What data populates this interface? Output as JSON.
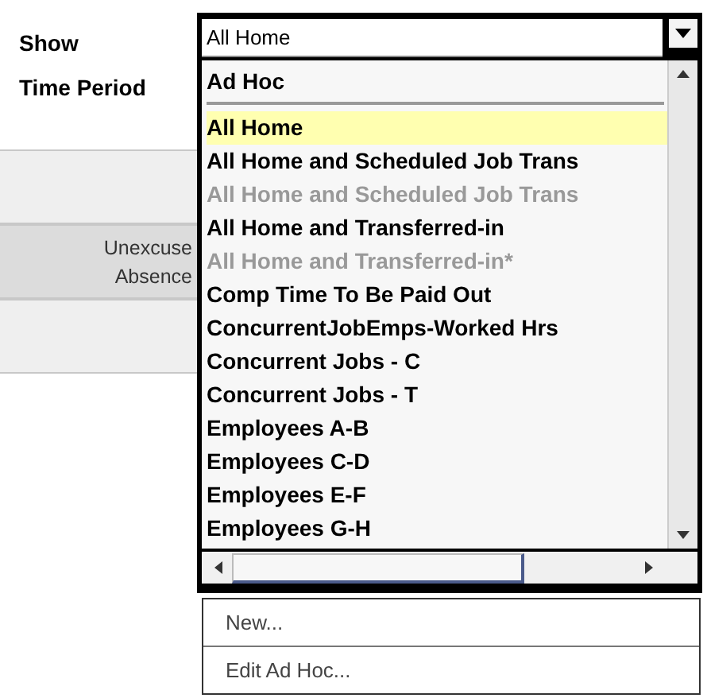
{
  "labels": [
    "Show",
    "Time Period"
  ],
  "rows": [
    {
      "kind": "blank"
    },
    {
      "kind": "text",
      "lines": [
        "Unexcuse",
        "Absence"
      ]
    },
    {
      "kind": "blank"
    }
  ],
  "dropdown": {
    "value": "All Home",
    "items": [
      {
        "kind": "heading",
        "label": "Ad Hoc"
      },
      {
        "kind": "option",
        "label": "All Home",
        "selected": true,
        "disabled": false
      },
      {
        "kind": "option",
        "label": "All Home and Scheduled Job Trans",
        "selected": false,
        "disabled": false
      },
      {
        "kind": "option",
        "label": "All Home and Scheduled Job Trans",
        "selected": false,
        "disabled": true
      },
      {
        "kind": "option",
        "label": "All Home and Transferred-in",
        "selected": false,
        "disabled": false
      },
      {
        "kind": "option",
        "label": "All Home and Transferred-in*",
        "selected": false,
        "disabled": true
      },
      {
        "kind": "option",
        "label": "Comp Time To Be Paid Out",
        "selected": false,
        "disabled": false
      },
      {
        "kind": "option",
        "label": "ConcurrentJobEmps-Worked Hrs",
        "selected": false,
        "disabled": false
      },
      {
        "kind": "option",
        "label": "Concurrent Jobs - C",
        "selected": false,
        "disabled": false
      },
      {
        "kind": "option",
        "label": "Concurrent Jobs - T",
        "selected": false,
        "disabled": false
      },
      {
        "kind": "option",
        "label": "Employees A-B",
        "selected": false,
        "disabled": false
      },
      {
        "kind": "option",
        "label": "Employees C-D",
        "selected": false,
        "disabled": false
      },
      {
        "kind": "option",
        "label": "Employees E-F",
        "selected": false,
        "disabled": false
      },
      {
        "kind": "option",
        "label": "Employees G-H",
        "selected": false,
        "disabled": false
      }
    ]
  },
  "menu": [
    "New...",
    "Edit Ad Hoc..."
  ]
}
